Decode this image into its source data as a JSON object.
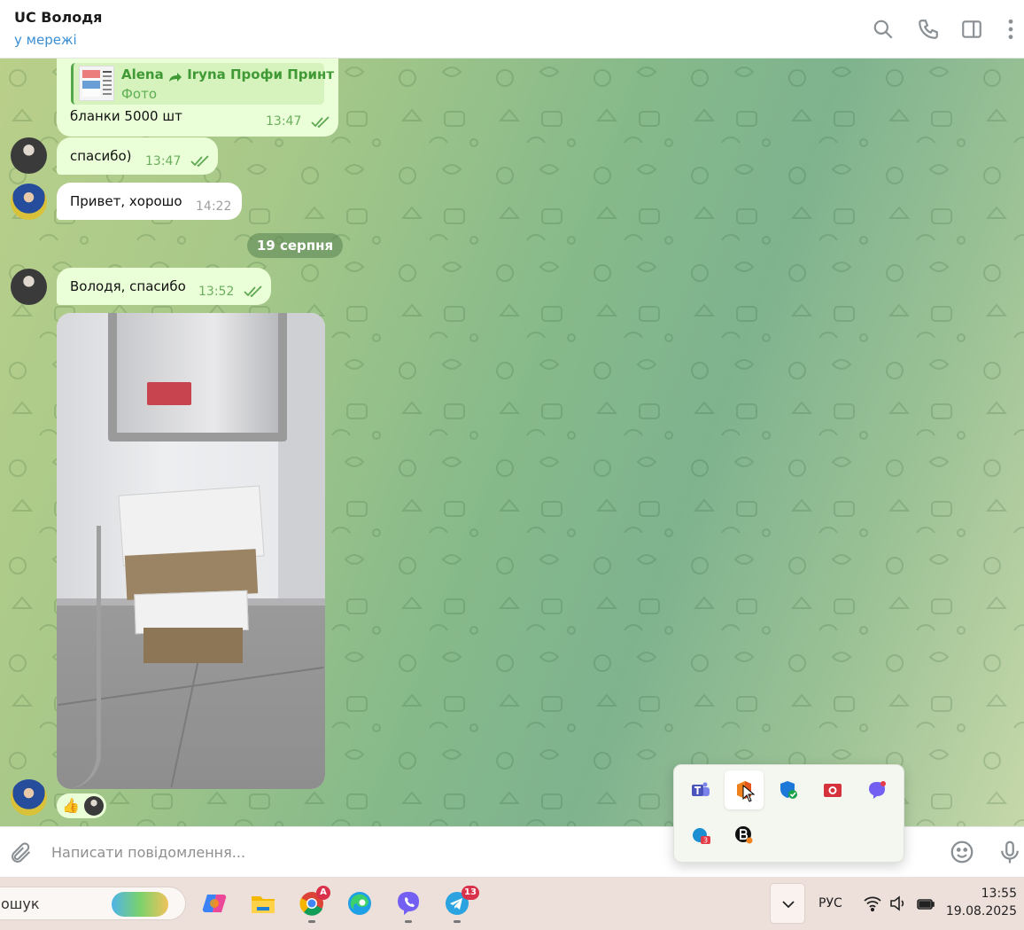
{
  "header": {
    "title": "UC Володя",
    "status": "у мережі",
    "icons": [
      "search-icon",
      "phone-icon",
      "sidebar-icon",
      "more-icon"
    ]
  },
  "messages": [
    {
      "reply_from": "Alena",
      "reply_forward_to": "Iryna Профи Принт",
      "reply_sub": "Фото",
      "text": "бланки 5000 шт",
      "time": "13:47",
      "status": "read"
    },
    {
      "text": "спасибо)",
      "time": "13:47",
      "status": "read"
    },
    {
      "text": "Привет, хорошо",
      "time": "14:22"
    },
    {
      "text": "Володя, спасибо",
      "time": "13:52",
      "status": "read"
    }
  ],
  "date_divider": "19 серпня",
  "photo_reaction": {
    "emoji": "👍"
  },
  "composer": {
    "placeholder": "Написати повідомлення..."
  },
  "tray_flyout": {
    "icons": [
      "teams-icon",
      "office-icon",
      "defender-icon",
      "camera-app-icon",
      "viber-icon",
      "app-badge-icon",
      "b-app-icon"
    ],
    "badge": "3"
  },
  "taskbar": {
    "search_text": "ошук",
    "apps": [
      {
        "name": "copilot-icon"
      },
      {
        "name": "file-explorer-icon"
      },
      {
        "name": "chrome-icon",
        "badge": "A"
      },
      {
        "name": "edge-icon"
      },
      {
        "name": "viber-icon"
      },
      {
        "name": "telegram-icon",
        "badge": "13"
      }
    ],
    "language": "РУС",
    "time": "13:55",
    "date": "19.08.2025"
  },
  "colors": {
    "bubble": "#eaffd8",
    "accent_green": "#56a64b",
    "status_blue": "#3a8ed4",
    "taskbar": "#eddfd9"
  }
}
